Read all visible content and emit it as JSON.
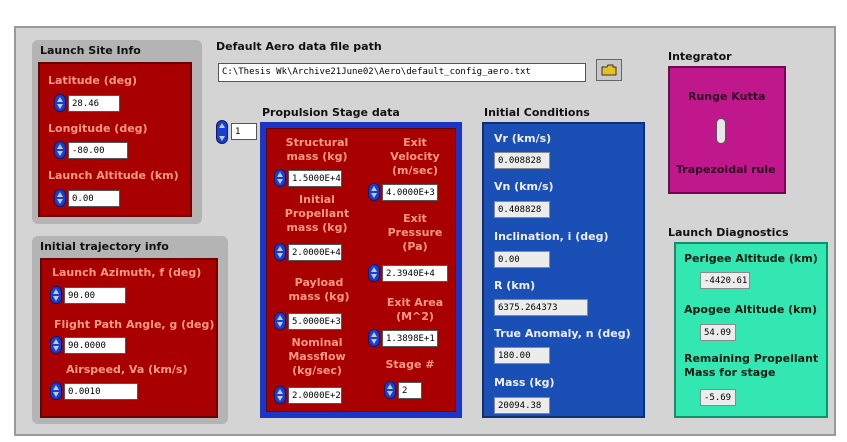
{
  "launch_site": {
    "title": "Launch Site Info",
    "latitude_label": "Latitude (deg)",
    "latitude_value": "28.46",
    "longitude_label": "Longitude (deg)",
    "longitude_value": "-80.00",
    "altitude_label": "Launch Altitude (km)",
    "altitude_value": "0.00"
  },
  "aero": {
    "title": "Default Aero data file path",
    "path": "C:\\Thesis Wk\\Archive21June02\\Aero\\default_config_aero.txt"
  },
  "propulsion": {
    "title": "Propulsion Stage data",
    "index_value": "1",
    "structural_label": "Structural mass (kg)",
    "structural_value": "1.5000E+4",
    "initial_prop_label": "Initial Propellant mass (kg)",
    "initial_prop_value": "2.0000E+4",
    "payload_label": "Payload mass (kg)",
    "payload_value": "5.0000E+3",
    "massflow_label": "Nominal Massflow (kg/sec)",
    "massflow_value": "2.0000E+2",
    "exit_velocity_label": "Exit Velocity (m/sec)",
    "exit_velocity_value": "4.0000E+3",
    "exit_pressure_label": "Exit Pressure (Pa)",
    "exit_pressure_value": "2.3940E+4",
    "exit_area_label": "Exit Area (M^2)",
    "exit_area_value": "1.3898E+1",
    "stage_label": "Stage #",
    "stage_value": "2"
  },
  "initial_conditions": {
    "title": "Initial Conditions",
    "vr_label": "Vr (km/s)",
    "vr_value": "0.008828",
    "vn_label": "Vn (km/s)",
    "vn_value": "0.408828",
    "incl_label": "Inclination, i (deg)",
    "incl_value": "0.00",
    "r_label": "R (km)",
    "r_value": "6375.264373",
    "ta_label": "True Anomaly, n (deg)",
    "ta_value": "180.00",
    "mass_label": "Mass (kg)",
    "mass_value": "20094.38"
  },
  "integrator": {
    "title": "Integrator",
    "option_top": "Runge Kutta",
    "option_bottom": "Trapezoidal rule"
  },
  "diagnostics": {
    "title": "Launch Diagnostics",
    "perigee_label": "Perigee Altitude (km)",
    "perigee_value": "-4420.61",
    "apogee_label": "Apogee Altitude (km)",
    "apogee_value": "54.09",
    "remaining_label": "Remaining Propellant Mass for stage",
    "remaining_value": "-5.69"
  },
  "trajectory": {
    "title": "Initial trajectory info",
    "azimuth_label": "Launch Azimuth, f (deg)",
    "azimuth_value": "90.00",
    "fpa_label": "Flight Path Angle, g (deg)",
    "fpa_value": "90.0000",
    "airspeed_label": "Airspeed, Va (km/s)",
    "airspeed_value": "0.0010"
  }
}
